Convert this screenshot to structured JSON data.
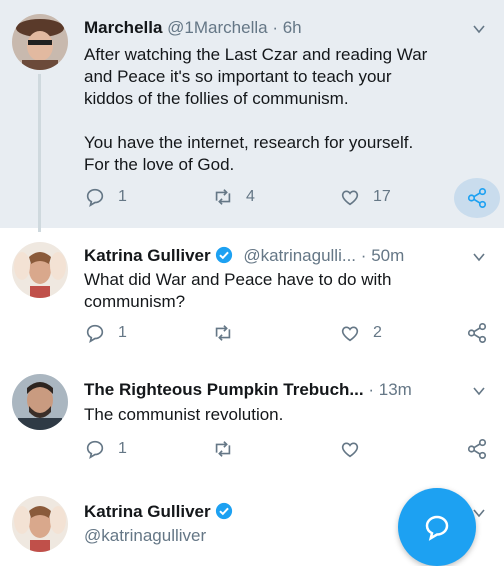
{
  "tweets": [
    {
      "name": "Marchella",
      "handle": "@1Marchella",
      "time": "6h",
      "text": [
        "After watching the Last Czar and reading War",
        "and Peace it's so important to teach your",
        "kiddos of the follies of communism."
      ],
      "text2": [
        "You have the internet, research for yourself.",
        "For the love of God."
      ],
      "replies": "1",
      "retweets": "4",
      "likes": "17"
    },
    {
      "name": "Katrina Gulliver",
      "handle": "@katrinagulli...",
      "time": "50m",
      "verified": true,
      "text": [
        "What did War and Peace have to do with",
        "communism?"
      ],
      "replies": "1",
      "likes": "2"
    },
    {
      "name": "The Righteous Pumpkin Trebuch...",
      "time": "13m",
      "text": [
        "The communist revolution."
      ],
      "replies": "1"
    },
    {
      "name": "Katrina Gulliver",
      "handle": "@katrinagulliver",
      "verified": true
    }
  ],
  "separator": "·",
  "icons": [
    "chevron-down-icon",
    "reply-icon",
    "retweet-icon",
    "like-icon",
    "share-icon",
    "verified-badge-icon",
    "compose-reply-icon"
  ],
  "colors": {
    "accent": "#1da1f2",
    "muted": "#657786",
    "highlight_bg": "#e8edf2"
  }
}
